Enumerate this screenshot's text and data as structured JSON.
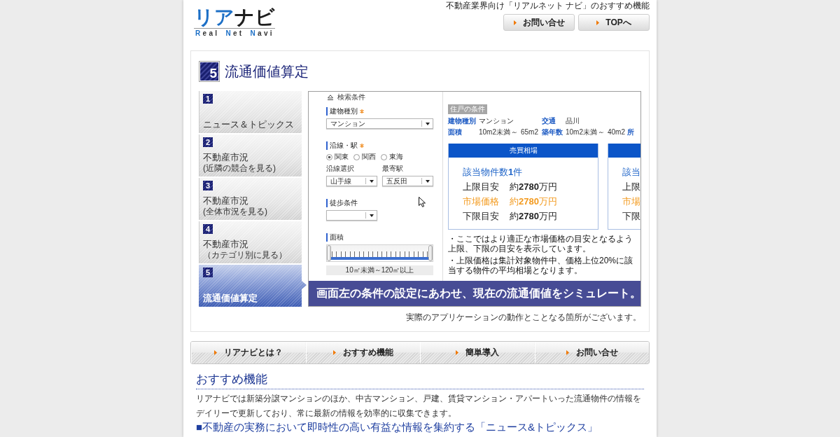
{
  "header": {
    "logo": {
      "wordmark": "リアナビ",
      "tagline": [
        "Real",
        "Net",
        "Navi"
      ]
    },
    "tagline": "不動産業界向け「リアルネット ナビ」のおすすめ機能",
    "buttons": [
      "お問い合せ",
      "TOPへ"
    ]
  },
  "feature": {
    "number": "5",
    "title": "流通価値算定",
    "tabs": [
      {
        "number": "1",
        "title": "ニュース＆トピックス",
        "selected": false
      },
      {
        "number": "2",
        "title": "不動産市況",
        "subtitle": "(近隣の競合を見る)",
        "selected": false
      },
      {
        "number": "3",
        "title": "不動産市況",
        "subtitle": "(全体市況を見る)",
        "selected": false
      },
      {
        "number": "4",
        "title": "不動産市況",
        "subtitle": "（カテゴリ別に見る）",
        "selected": false
      },
      {
        "number": "5",
        "title": "流通価値算定",
        "selected": true
      }
    ],
    "app": {
      "search": {
        "title": "検索条件",
        "fields": [
          {
            "kind": "select",
            "label": "建物種別",
            "required": true,
            "value": "マンション"
          },
          {
            "kind": "region",
            "label": "沿線・駅",
            "required": true,
            "options": [
              {
                "label": "関東",
                "selected": true
              },
              {
                "label": "関西",
                "selected": false
              },
              {
                "label": "東海",
                "selected": false
              }
            ],
            "selects": [
              {
                "label": "沿線選択",
                "value": "山手線"
              },
              {
                "label": "最寄駅",
                "value": "五反田"
              }
            ]
          },
          {
            "kind": "select",
            "label": "徒歩条件",
            "required": false
          },
          {
            "kind": "slider",
            "label": "面積",
            "required": false,
            "level": 1,
            "reading": "10㎡未満～120㎡以上"
          }
        ]
      },
      "conditions": {
        "tag": "住戸の条件",
        "rows": [
          [
            {
              "kind": "label",
              "text": "建物種別"
            },
            {
              "kind": "value",
              "text": "マンション"
            },
            {
              "kind": "value",
              "text": ""
            },
            {
              "kind": "value",
              "text": ""
            },
            {
              "kind": "label",
              "text": "交通"
            },
            {
              "kind": "value",
              "text": "品川"
            }
          ],
          [
            {
              "kind": "label",
              "text": "面積"
            },
            {
              "kind": "value",
              "text": "10m2未満"
            },
            {
              "kind": "value",
              "text": "～"
            },
            {
              "kind": "value",
              "text": "65m2"
            },
            {
              "kind": "label",
              "text": "築年数"
            },
            {
              "kind": "value",
              "text": "10m2未満"
            },
            {
              "kind": "value",
              "text": "～"
            },
            {
              "kind": "value",
              "text": "40m2"
            },
            {
              "kind": "label",
              "text": "所"
            }
          ]
        ]
      },
      "results": [
        {
          "header": "売買相場",
          "count": "該当物件数**1**件",
          "rows": [
            {
              "label": "上限目安",
              "value": "約**2780**万円",
              "highlighted": false
            },
            {
              "label": "市場価格",
              "value": "約**2780**万円",
              "highlighted": true
            },
            {
              "label": "下限目安",
              "value": "約**2780**万円",
              "highlighted": false
            }
          ]
        },
        {
          "count": "該当",
          "rows": [
            {
              "label": "上限",
              "highlighted": false
            },
            {
              "label": "市場",
              "highlighted": true
            },
            {
              "label": "下限",
              "highlighted": false
            }
          ]
        }
      ],
      "notes": [
        "・ここではより適正な市場価格の目安となるよう上限、下限の目安を表示しています。",
        "・上限価格は集計対象物件中、価格上位20%に該当する物件の平均相場となります。"
      ],
      "banner": "画面左の条件の設定にあわせ、現在の流通価値をシミュレート。"
    },
    "note": "実際のアプリケーションの動作とことなる箇所がございます。"
  },
  "nav": [
    "リアナビとは？",
    "おすすめ機能",
    "簡単導入",
    "お問い合せ"
  ],
  "intro": {
    "heading": "おすすめ機能",
    "text": "リアナビでは新築分譲マンションのほか、中古マンション、戸建、賃貸マンション・アパートいった流通物件の情報をデイリーで更新しており、常に最新の情報を効率的に収集できます。",
    "subheading": "■不動産の実務において即時性の高い有益な情報を集約する「ニュース&トピックス」"
  }
}
